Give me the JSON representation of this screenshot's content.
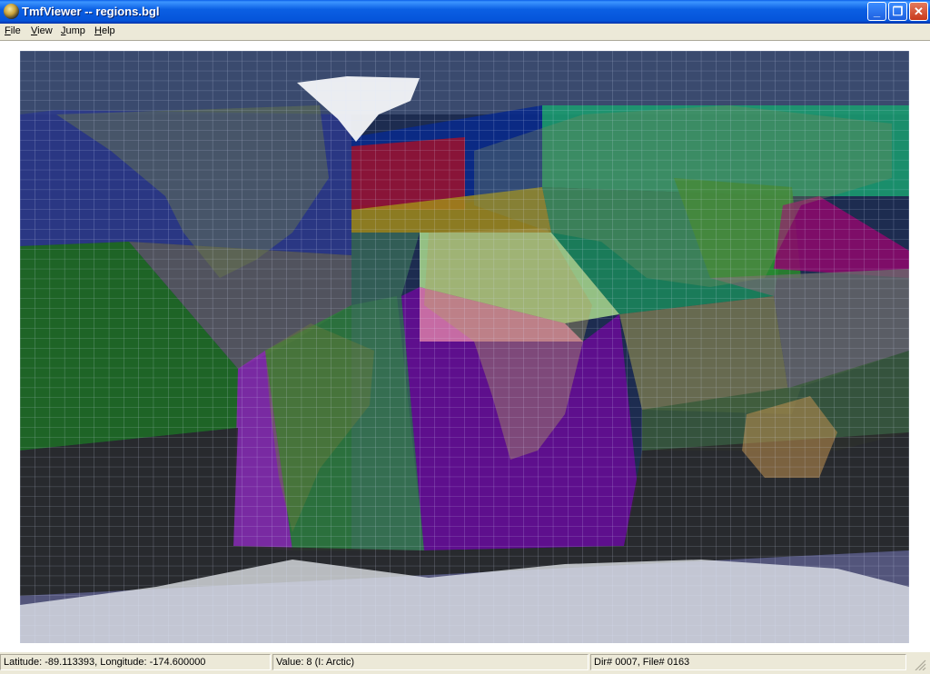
{
  "window": {
    "title": "TmfViewer -- regions.bgl",
    "buttons": {
      "minimize": "_",
      "maximize": "❐",
      "close": "✕"
    }
  },
  "menu": {
    "items": [
      "File",
      "View",
      "Jump",
      "Help"
    ]
  },
  "status": {
    "coords": "Latitude: -89.113393, Longitude: -174.600000",
    "value": "Value: 8 (I: Arctic)",
    "dir_file": "Dir# 0007, File# 0163"
  },
  "map": {
    "region_colors": {
      "north_america": "#2d3a8c",
      "central_america": "#5a5a60",
      "pacific_east": "#1e6e1e",
      "south_america": "#2e7d3a",
      "south_america_west": "#8a2ab0",
      "atlantic_south": "#3a6e58",
      "africa_south": "#6a0a98",
      "africa_north": "#c8ff9a",
      "sahel": "#ff80c0",
      "europe_west": "#0a2a8a",
      "uk_region": "#a0102a",
      "mediterranean": "#a08a1a",
      "russia": "#1aa070",
      "middle_east": "#1a8a5a",
      "china": "#2a8a2a",
      "japan": "#8a0a6a",
      "se_asia": "#6a6a6a",
      "australia": "#3a5a3a",
      "indian_ocean": "#7a7a50",
      "south_ocean": "#2a2a2a",
      "antarctica": "#5a5a80",
      "ocean": "#1d2c50"
    }
  }
}
